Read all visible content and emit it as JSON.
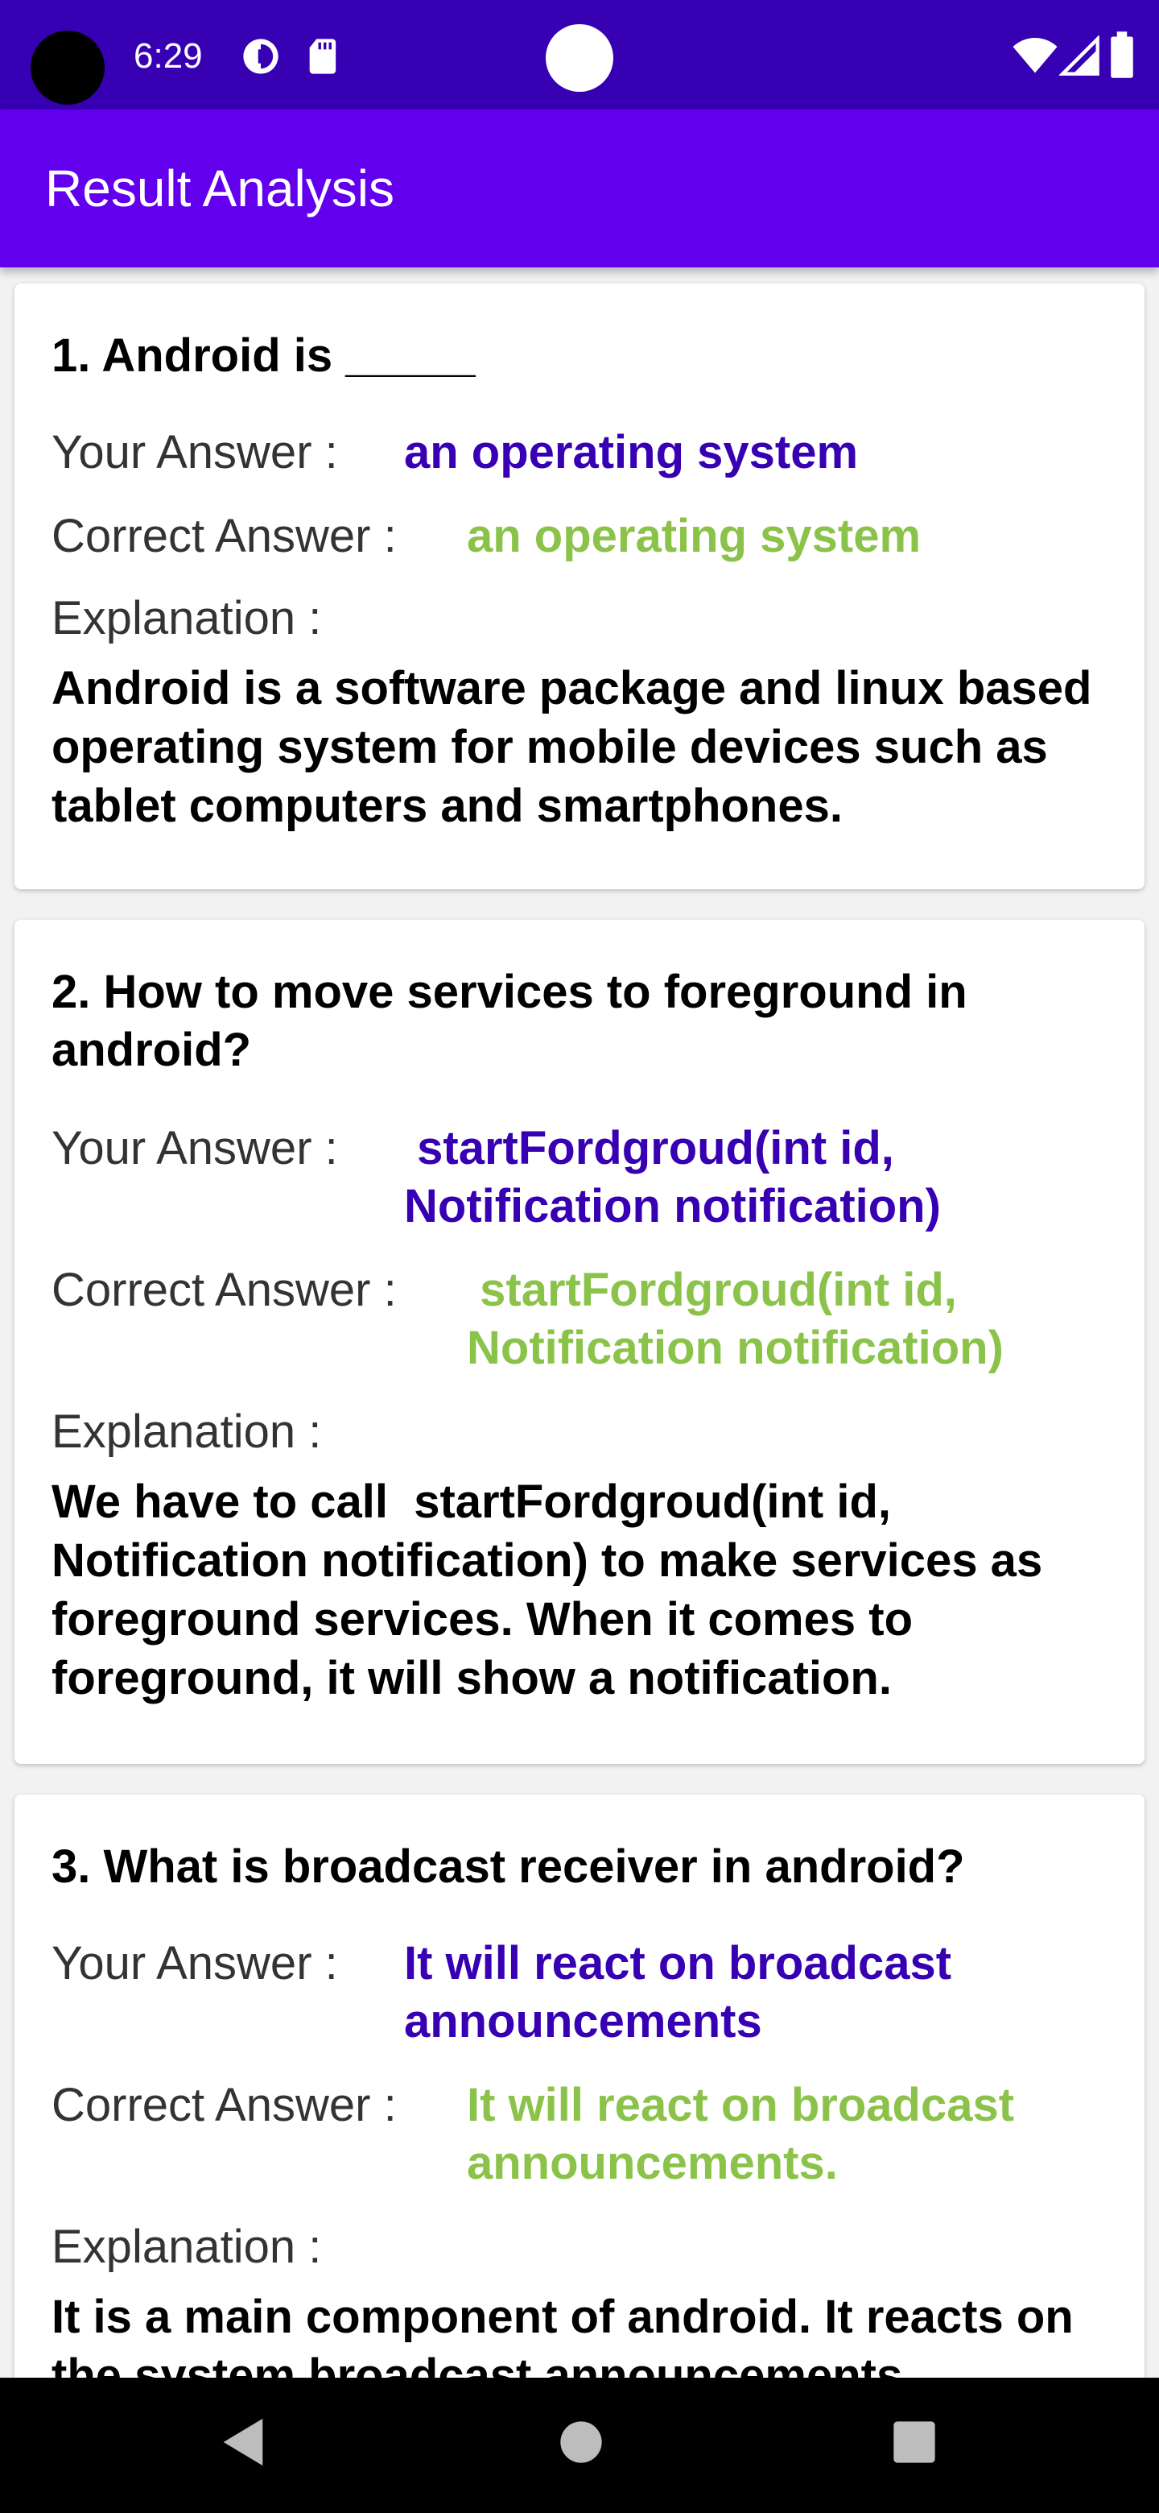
{
  "status_bar": {
    "time": "6:29",
    "icons": [
      "camera-hole",
      "data-saver-icon",
      "sd-card-icon",
      "center-dot",
      "wifi-icon",
      "signal-icon",
      "battery-icon"
    ]
  },
  "app_bar": {
    "title": "Result Analysis",
    "background": "#6200ee"
  },
  "labels": {
    "your_answer": "Your Answer :",
    "correct_answer": "Correct Answer :",
    "explanation": "Explanation :"
  },
  "colors": {
    "status_bar": "#3700b3",
    "your_answer": "#3700b3",
    "correct_answer": "#8bc34a"
  },
  "questions": [
    {
      "title": "1. Android is _____",
      "your_answer": "an operating system",
      "correct_answer": "an operating system",
      "explanation": "Android is a software package and linux based operating system for mobile devices such as tablet computers and smartphones."
    },
    {
      "title": "2. How to move services to foreground in android?",
      "your_answer": " startFordgroud(int id, Notification notification)",
      "correct_answer": " startFordgroud(int id, Notification notification)",
      "explanation": "We have to call  startFordgroud(int id, Notification notification) to make services as foreground services. When it comes to foreground, it will show a notification."
    },
    {
      "title": "3. What is broadcast receiver in android?",
      "your_answer": "It will react on broadcast announcements",
      "correct_answer": "It will react on broadcast announcements.",
      "explanation": "It is a main component of android. It reacts on the system broadcast announcements."
    }
  ],
  "nav_bar": {
    "buttons": [
      "back-icon",
      "home-icon",
      "recents-icon"
    ]
  }
}
